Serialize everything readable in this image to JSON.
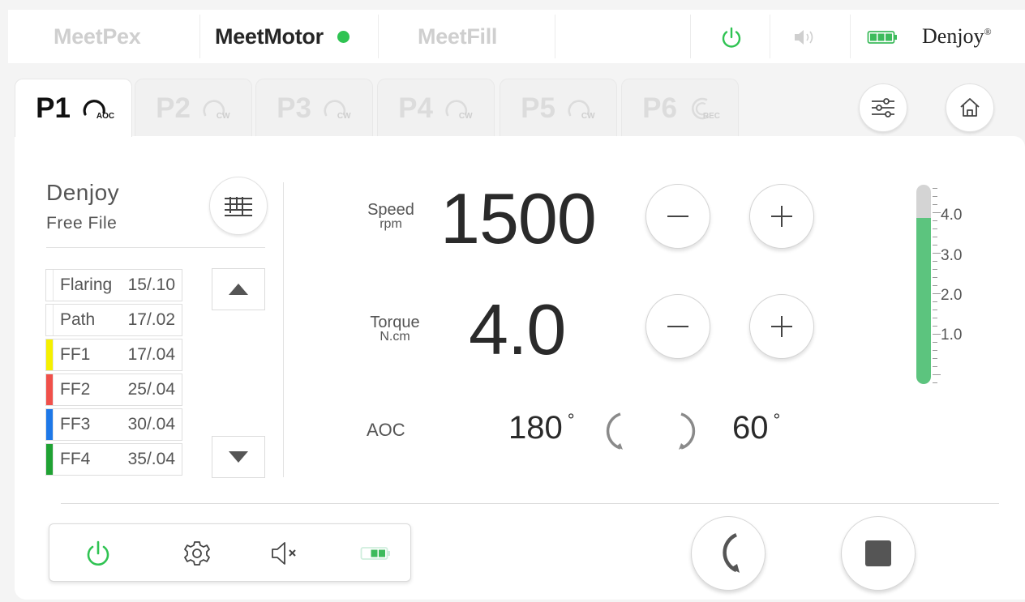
{
  "top_bar": {
    "apps": [
      {
        "label": "MeetPex",
        "active": false
      },
      {
        "label": "MeetMotor",
        "active": true
      },
      {
        "label": "MeetFill",
        "active": false
      }
    ],
    "brand": "Denjoy",
    "brand_mark": "®",
    "icons": [
      "power-icon",
      "volume-icon",
      "battery-icon"
    ]
  },
  "program_tabs": [
    {
      "label": "P1",
      "mode": "AOC",
      "active": true
    },
    {
      "label": "P2",
      "mode": "CW",
      "active": false
    },
    {
      "label": "P3",
      "mode": "CW",
      "active": false
    },
    {
      "label": "P4",
      "mode": "CW",
      "active": false
    },
    {
      "label": "P5",
      "mode": "CW",
      "active": false
    },
    {
      "label": "P6",
      "mode": "REC",
      "active": false
    }
  ],
  "file_system": {
    "brand": "Denjoy",
    "name": "Free File",
    "files": [
      {
        "name": "Flaring",
        "size": "15/.10",
        "color": ""
      },
      {
        "name": "Path",
        "size": "17/.02",
        "color": ""
      },
      {
        "name": "FF1",
        "size": "17/.04",
        "color": "#f5f000"
      },
      {
        "name": "FF2",
        "size": "25/.04",
        "color": "#f0504a"
      },
      {
        "name": "FF3",
        "size": "30/.04",
        "color": "#1e78e8"
      },
      {
        "name": "FF4",
        "size": "35/.04",
        "color": "#1fa233"
      }
    ]
  },
  "speed": {
    "label": "Speed",
    "unit": "rpm",
    "value": "1500"
  },
  "torque": {
    "label": "Torque",
    "unit": "N.cm",
    "value": "4.0"
  },
  "aoc": {
    "label": "AOC",
    "ccw_angle": "180",
    "cw_angle": "60",
    "degree_symbol": "°"
  },
  "torque_gauge": {
    "ticks": [
      "4.0",
      "3.0",
      "2.0",
      "1.0"
    ],
    "level": 4.0,
    "max": 4.8,
    "fill_color": "#5cc47e"
  },
  "colors": {
    "accent_green": "#2fc352",
    "battery_green": "#3dbb5c"
  }
}
